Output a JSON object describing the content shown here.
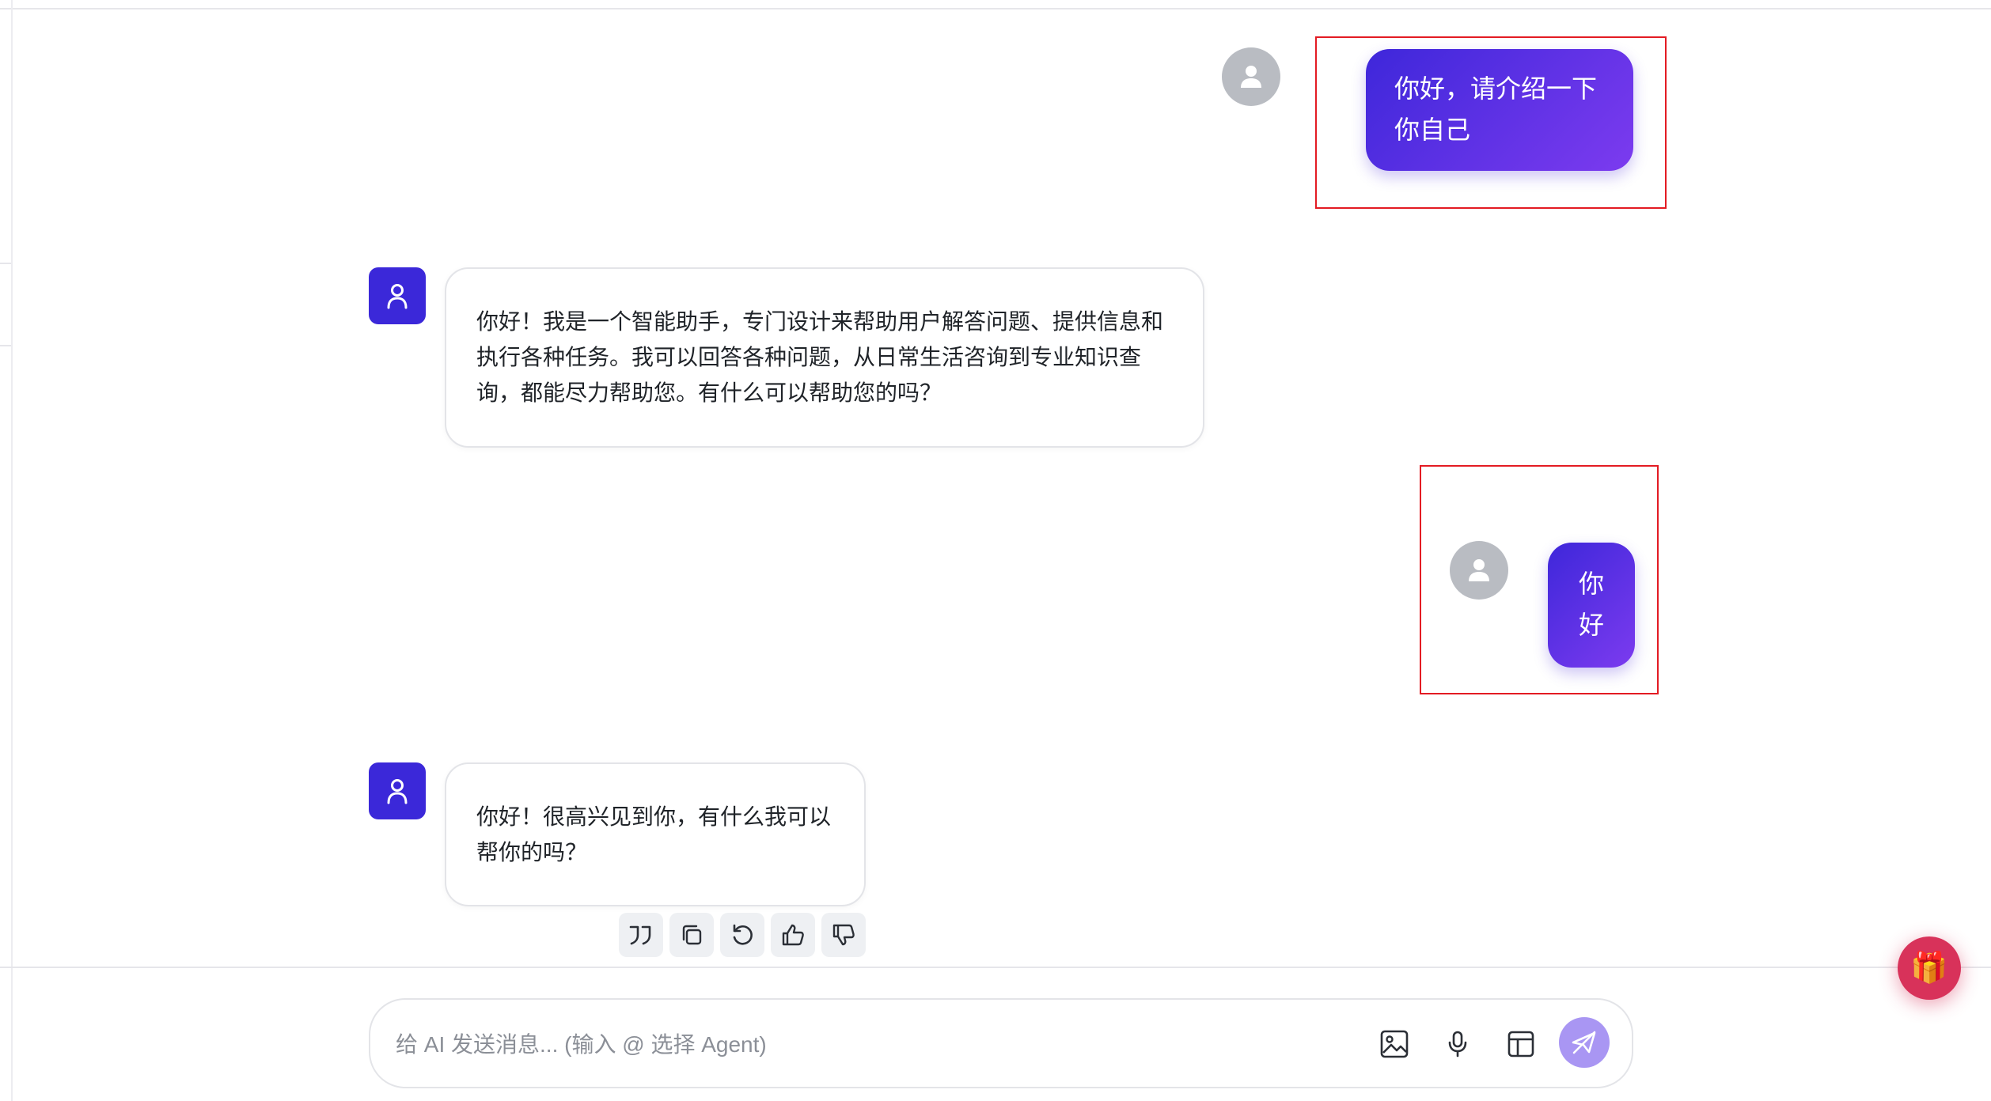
{
  "messages": [
    {
      "role": "user",
      "text_lines": [
        "你好，请介绍一下",
        "你自己"
      ]
    },
    {
      "role": "assistant",
      "text_lines": [
        "你好！我是一个智能助手，专门设计来帮助用户解答问题、提供信息和",
        "执行各种任务。我可以回答各种问题，从日常生活咨询到专业知识查",
        "询，都能尽力帮助您。有什么可以帮助您的吗？"
      ]
    },
    {
      "role": "user",
      "text_lines": [
        "你",
        "好"
      ]
    },
    {
      "role": "assistant",
      "text_lines": [
        "你好！很高兴见到你，有什么我可以",
        "帮你的吗？"
      ]
    }
  ],
  "message_actions": [
    "quote-icon",
    "copy-icon",
    "regenerate-icon",
    "thumbs-up-icon",
    "thumbs-down-icon"
  ],
  "composer": {
    "placeholder": "给 AI 发送消息... (输入 @ 选择 Agent)",
    "value": "",
    "tools": [
      "image-icon",
      "microphone-icon",
      "layout-icon"
    ],
    "send_icon": "send-icon"
  },
  "floating": {
    "icon": "gift-icon",
    "glyph": "🎁"
  },
  "colors": {
    "brand": "#3b28d9",
    "user_bubble_start": "#3e27da",
    "user_bubble_end": "#7c3bef",
    "send_button": "#a996f3",
    "annotation_box": "#e31b23",
    "gift_button": "#d8325a"
  }
}
